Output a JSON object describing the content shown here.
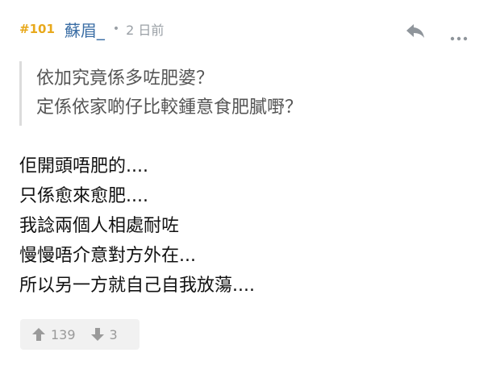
{
  "header": {
    "floor": "#101",
    "username": "蘇眉_",
    "separator": "•",
    "time": "2 日前"
  },
  "icons": {
    "reply": "reply-icon",
    "more": "more-icon",
    "upvote": "thumb-up-arrow-icon",
    "downvote": "thumb-down-arrow-icon"
  },
  "quote": {
    "lines": [
      "依加究竟係多咗肥婆？",
      "定係依家啲仔比較鍾意食肥膩嘢？"
    ]
  },
  "content": {
    "lines": [
      "佢開頭唔肥的....",
      "只係愈來愈肥....",
      "我諗兩個人相處耐咗",
      "慢慢唔介意對方外在...",
      "所以另一方就自己自我放蕩...."
    ]
  },
  "votes": {
    "up": "139",
    "down": "3"
  },
  "colors": {
    "floor": "#e8a91c",
    "username": "#3b6ea5",
    "muted": "#9aa0a6"
  }
}
